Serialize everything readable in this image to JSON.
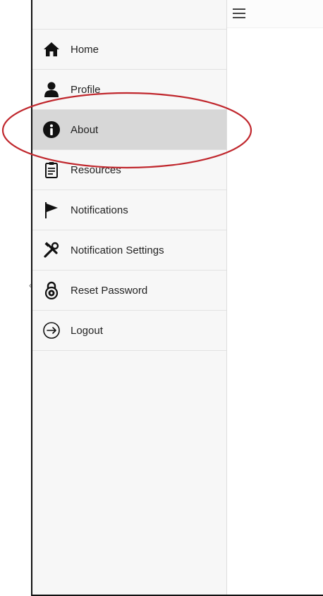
{
  "menu": {
    "items": [
      {
        "label": "Home",
        "icon": "home-icon"
      },
      {
        "label": "Profile",
        "icon": "user-icon"
      },
      {
        "label": "About",
        "icon": "info-icon"
      },
      {
        "label": "Resources",
        "icon": "clipboard-icon"
      },
      {
        "label": "Notifications",
        "icon": "flag-icon"
      },
      {
        "label": "Notification Settings",
        "icon": "tools-icon"
      },
      {
        "label": "Reset Password",
        "icon": "padlock-icon"
      },
      {
        "label": "Logout",
        "icon": "logout-icon"
      }
    ],
    "active_label": "About"
  },
  "header": {
    "menu_icon": "hamburger-icon"
  },
  "annotation": {
    "color": "#c0272d"
  }
}
